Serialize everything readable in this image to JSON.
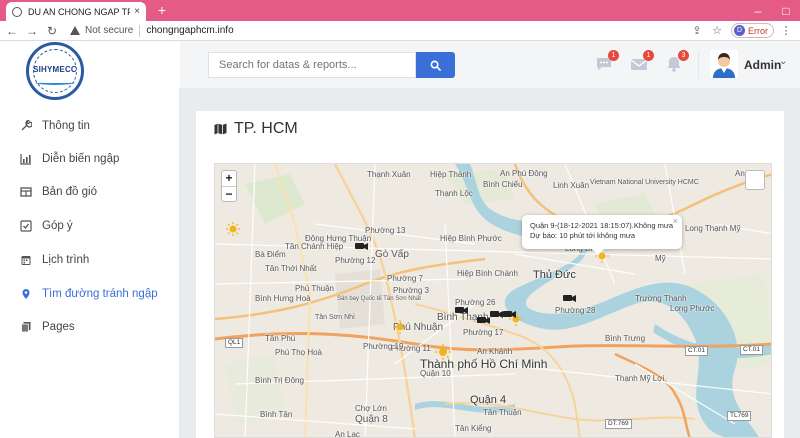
{
  "browser": {
    "tab_title": "DU AN CHONG NGAP TP.HCM",
    "tab_close": "×",
    "new_tab": "+",
    "security": "Not secure",
    "url": "chongngaphcm.info",
    "error_label": "Error",
    "profile_initial": "D"
  },
  "logo": {
    "text": "SIHYMECC"
  },
  "header": {
    "search_placeholder": "Search for datas & reports...",
    "alerts": [
      {
        "icon": "chat-icon",
        "count": "1"
      },
      {
        "icon": "envelope-icon",
        "count": "1"
      },
      {
        "icon": "bell-icon",
        "count": "3"
      }
    ],
    "user_name": "Admin"
  },
  "sidebar": {
    "items": [
      {
        "label": "Thông tin",
        "icon": "tools-icon"
      },
      {
        "label": "Diễn biến ngập",
        "icon": "chart-icon"
      },
      {
        "label": "Bản đồ gió",
        "icon": "table-icon"
      },
      {
        "label": "Góp ý",
        "icon": "checkbox-icon"
      },
      {
        "label": "Lịch trình",
        "icon": "calendar-icon"
      },
      {
        "label": "Tìm đường tránh ngập",
        "icon": "map-marker-icon",
        "active": true
      },
      {
        "label": "Pages",
        "icon": "copy-icon"
      }
    ]
  },
  "page": {
    "title": "TP. HCM"
  },
  "map": {
    "zoom_in": "+",
    "zoom_out": "−",
    "popup": {
      "line1": "Quận 9-(18-12-2021 18:15:07).Không mưa",
      "line2": "Dự báo: 10 phút tới không mưa",
      "close": "×"
    },
    "labels": [
      "Thạnh Xuân",
      "Hiệp Thành",
      "Phường 13",
      "Đông Hưng Thuận",
      "Tân Chánh Hiệp",
      "Phường 12",
      "Gò Vấp",
      "Thạnh Lộc",
      "An Phú Đông",
      "Bình Chiểu",
      "Linh Xuân",
      "Vietnam National University HCMC",
      "Hiệp Bình Phước",
      "Thủ Đức",
      "Phường 7",
      "Hiệp Bình Chánh",
      "Phường 3",
      "Bà Điểm",
      "Tân Thới Nhất",
      "Bình Hưng Hoà",
      "Sân bay Quốc tế Tân Sơn Nhất",
      "Phú Nhuận",
      "Bình Thạnh",
      "Phường 26",
      "Phường 28",
      "Phường 17",
      "An Khánh",
      "Bình Trưng",
      "Thạnh Mỹ Lợi",
      "Trường Thạnh",
      "Long Phước",
      "Phường 11",
      "Tân Phú",
      "Phú Thọ Hoà",
      "Thành phố Hồ Chí Minh",
      "Quận 10",
      "Quận 4",
      "Quận 8",
      "Bình Trị Đông",
      "Bình Tân",
      "Chợ Lớn",
      "Tân Thuận",
      "Tân Kiểng",
      "An Lạc",
      "Long Thạnh Mỹ",
      "Long Bình",
      "An Hội",
      "Mỹ",
      "Phường 19",
      "Phú Thuận",
      "Tân Sơn Nhì"
    ],
    "road_labels": [
      "QL1",
      "CT.01",
      "CT.01",
      "DT.769",
      "TL769"
    ]
  }
}
